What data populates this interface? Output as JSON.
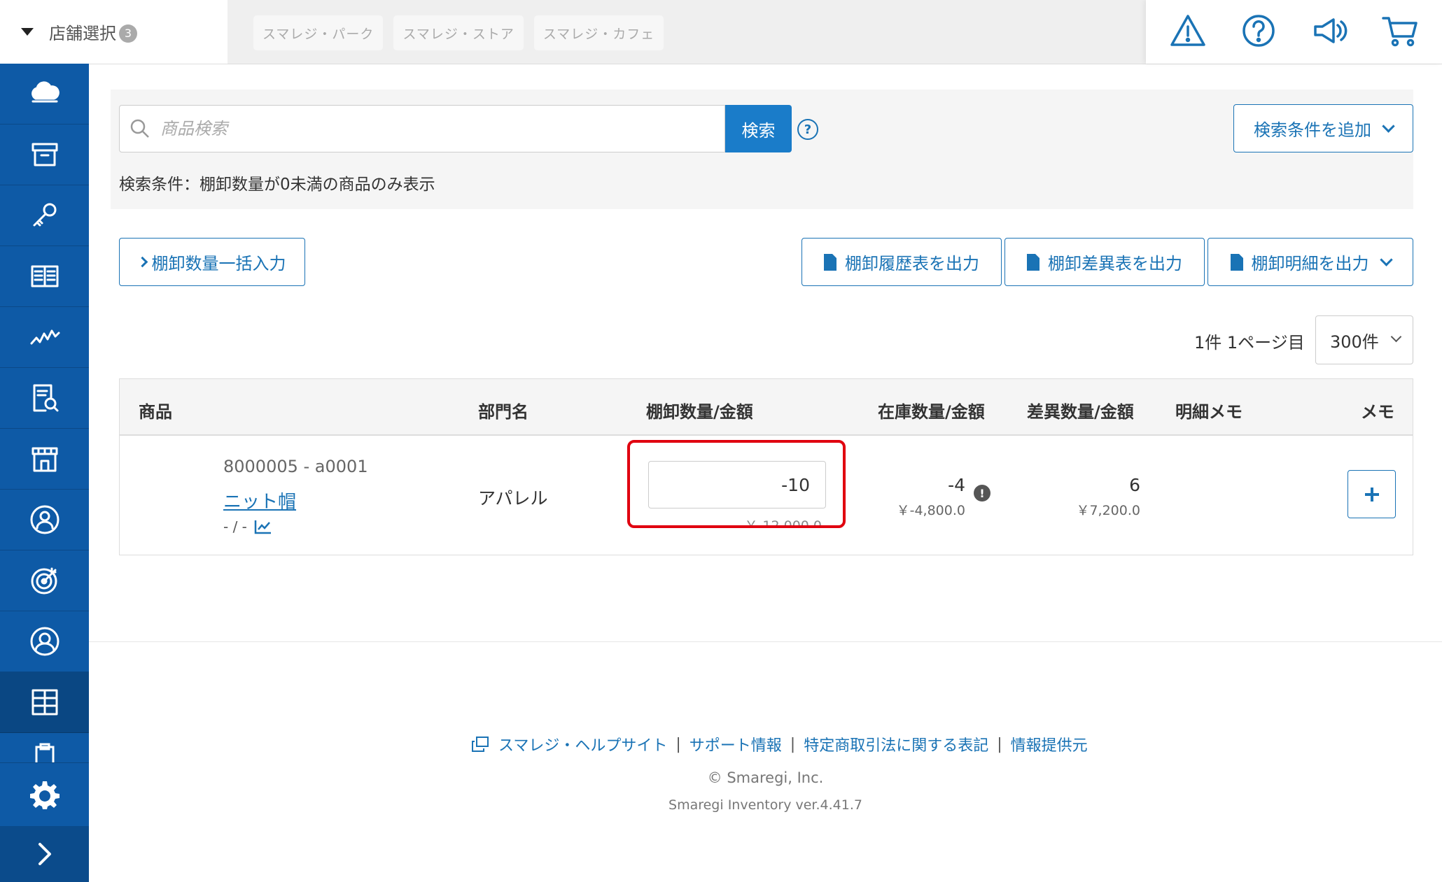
{
  "topbar": {
    "store_select_label": "店舗選択",
    "store_count": "3",
    "store_tabs": [
      "スマレジ・パーク",
      "スマレジ・ストア",
      "スマレジ・カフェ"
    ],
    "icons": [
      "warning-icon",
      "help-icon",
      "megaphone-icon",
      "cart-icon"
    ]
  },
  "sidebar": {
    "items": [
      "cloud-icon",
      "archive-icon",
      "key-icon",
      "book-icon",
      "chart-line-icon",
      "report-icon",
      "store-icon",
      "user-badge-icon",
      "target-icon",
      "user-circle-icon",
      "grid-icon",
      "clipboard-icon"
    ],
    "active_index": 10
  },
  "search": {
    "placeholder": "商品検索",
    "value": "",
    "button_label": "検索",
    "help_label": "?",
    "add_condition_label": "検索条件を追加",
    "condition_text": "検索条件：棚卸数量が0未満の商品のみ表示"
  },
  "actions": {
    "bulk_input_label": "棚卸数量一括入力",
    "history_label": "棚卸履歴表を出力",
    "diff_label": "棚卸差異表を出力",
    "detail_label": "棚卸明細を出力"
  },
  "pagination": {
    "info": "1件 1ページ目",
    "per_page": "300件"
  },
  "table": {
    "headers": {
      "product": "商品",
      "dept": "部門名",
      "inventory": "棚卸数量/金額",
      "stock": "在庫数量/金額",
      "diff": "差異数量/金額",
      "detail_memo": "明細メモ",
      "memo": "メモ"
    },
    "rows": [
      {
        "code": "8000005 - a0001",
        "name": "ニット帽",
        "meta": "- / -",
        "dept": "アパレル",
        "inventory_qty": "-10",
        "inventory_amount": "￥-12,000.0",
        "stock_qty": "-4",
        "stock_amount": "￥-4,800.0",
        "diff_qty": "6",
        "diff_amount": "￥7,200.0",
        "memo_button": "+"
      }
    ]
  },
  "highlight_color": "#e0000f",
  "accent_color": "#1a73b5",
  "sidebar_color": "#0e5aa6",
  "footer": {
    "links": [
      "スマレジ・ヘルプサイト",
      "サポート情報",
      "特定商取引法に関する表記",
      "情報提供元"
    ],
    "separator": "|",
    "copyright": "© Smaregi, Inc.",
    "version": "Smaregi Inventory ver.4.41.7"
  }
}
